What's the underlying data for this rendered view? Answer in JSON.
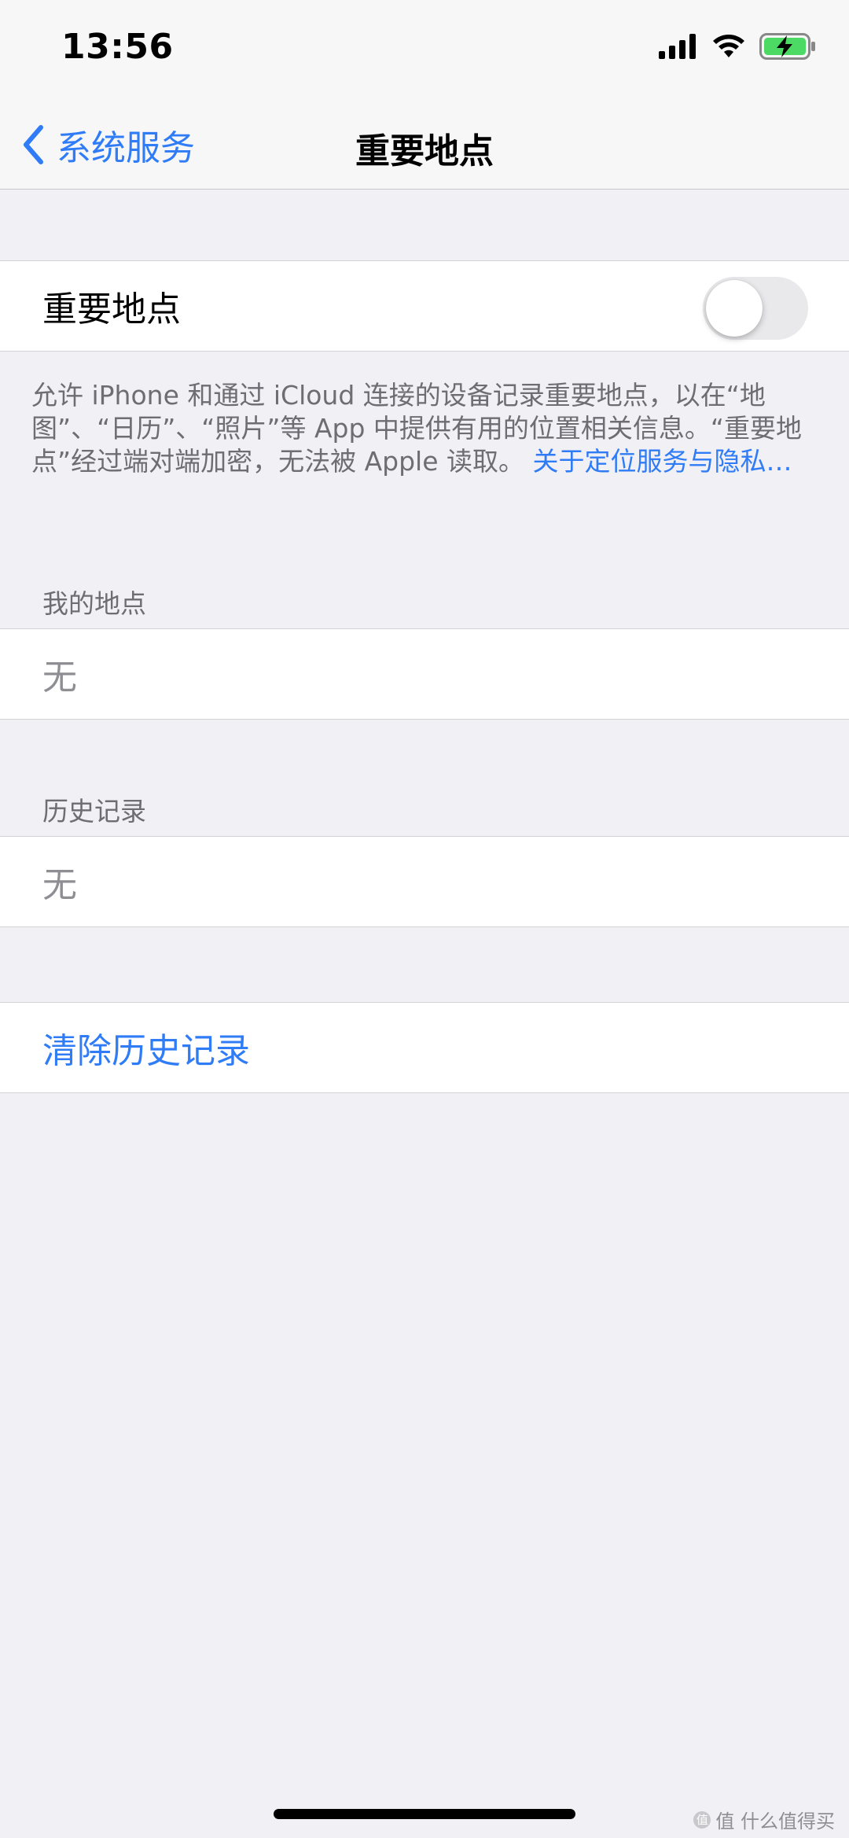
{
  "status_bar": {
    "time": "13:56"
  },
  "nav": {
    "back_label": "系统服务",
    "title": "重要地点"
  },
  "toggle_row": {
    "label": "重要地点",
    "enabled": false
  },
  "footnote": {
    "text": "允许 iPhone 和通过 iCloud 连接的设备记录重要地点，以在“地图”、“日历”、“照片”等 App 中提供有用的位置相关信息。“重要地点”经过端对端加密，无法被 Apple 读取。",
    "link": "关于定位服务与隐私…"
  },
  "my_places": {
    "header": "我的地点",
    "value": "无"
  },
  "history": {
    "header": "历史记录",
    "value": "无"
  },
  "clear_history": {
    "label": "清除历史记录"
  },
  "watermark": {
    "text": "值 什么值得买",
    "logo_glyph": "值"
  },
  "colors": {
    "accent": "#2f7cf6",
    "background": "#f0f0f5",
    "secondary_text": "#6d6d72",
    "battery_green": "#4cd964"
  }
}
